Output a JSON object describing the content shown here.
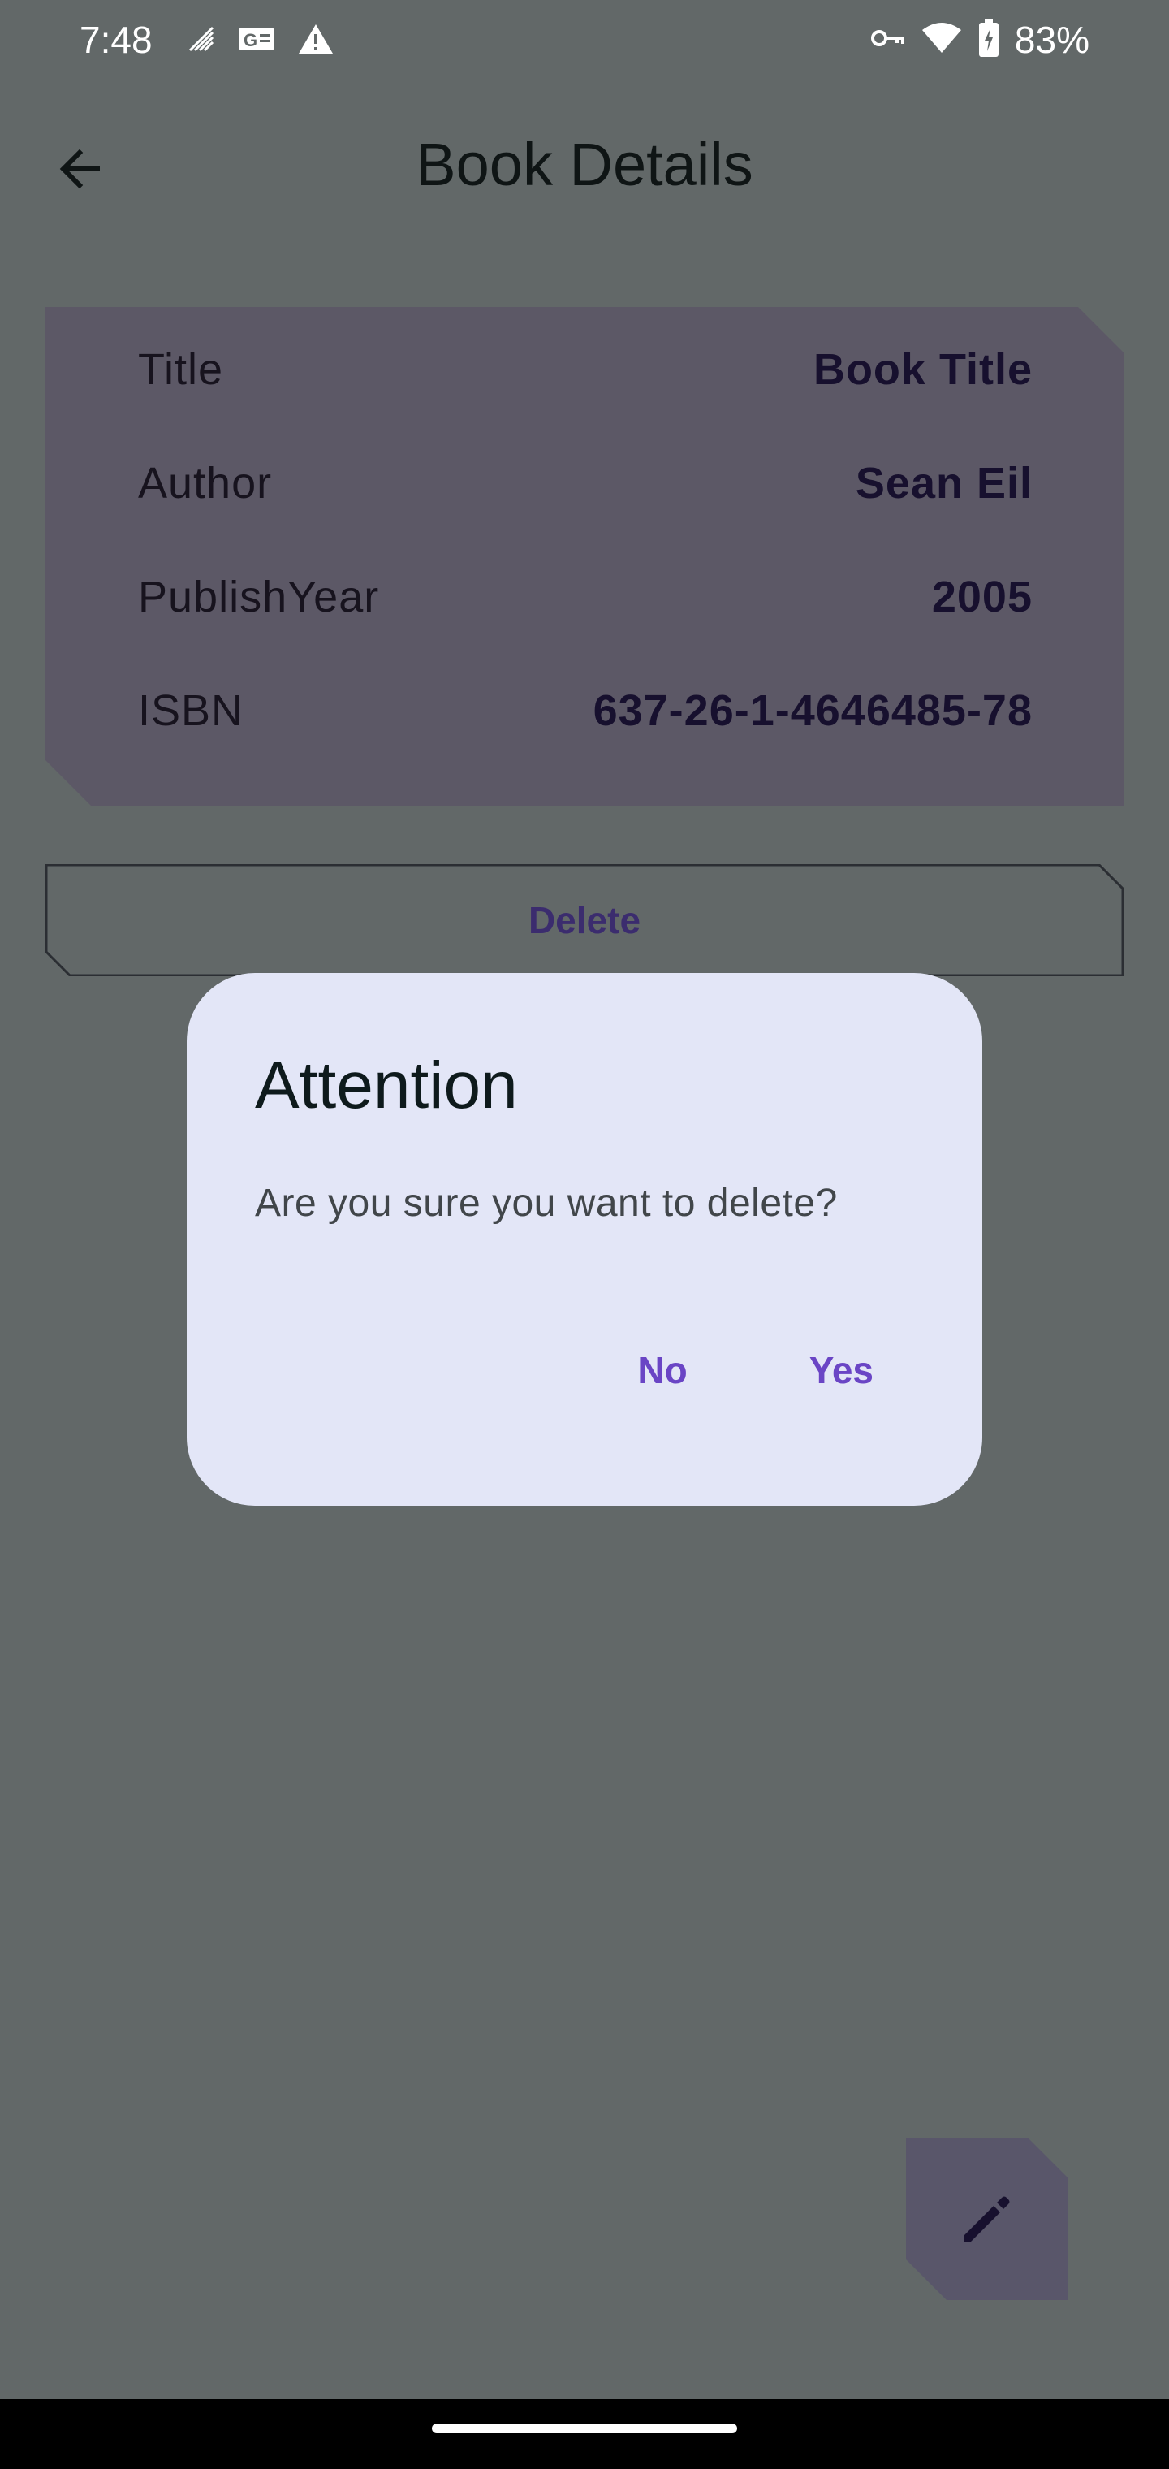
{
  "status_bar": {
    "time": "7:48",
    "battery": "83%",
    "icons": [
      "signal-icon",
      "sim-card-icon",
      "warning-icon",
      "vpn-key-icon",
      "wifi-icon",
      "battery-charging-icon"
    ]
  },
  "app_bar": {
    "title": "Book Details",
    "back_icon": "arrow-back-icon"
  },
  "details": {
    "rows": [
      {
        "label": "Title",
        "value": "Book Title"
      },
      {
        "label": "Author",
        "value": "Sean Eil"
      },
      {
        "label": "PublishYear",
        "value": "2005"
      },
      {
        "label": "ISBN",
        "value": "637-26-1-4646485-78"
      }
    ]
  },
  "delete_button": {
    "label": "Delete"
  },
  "dialog": {
    "title": "Attention",
    "message": "Are you sure you want to delete?",
    "no_label": "No",
    "yes_label": "Yes"
  },
  "fab": {
    "icon": "edit-pencil-icon"
  },
  "colors": {
    "scrim_background": "#626868",
    "card_background": "#5c5866",
    "dialog_background": "#e3e6f7",
    "accent": "#6a45c5"
  }
}
